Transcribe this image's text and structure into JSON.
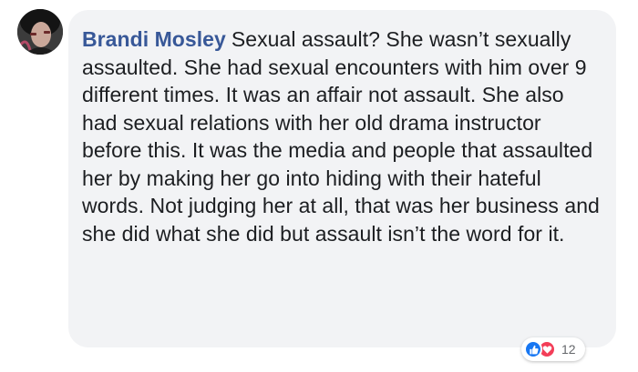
{
  "comment": {
    "author": "Brandi Mosley",
    "text": "Sexual assault? She wasn’t sexually assaulted. She had sexual encounters with him over 9 different times. It was an affair not assault. She also had sexual relations with her old drama instructor before this. It was the media and people that assaulted her by making her go into hiding with their hateful words. Not judging her at all, that was her business and she did what she did but assault isn’t the word for it.",
    "reactions": {
      "icons": [
        "like-icon",
        "love-icon"
      ],
      "count": "12"
    }
  },
  "colors": {
    "author": "#385898",
    "bubble": "#f2f3f5",
    "like": "#1877f2",
    "love": "#f33e58"
  }
}
